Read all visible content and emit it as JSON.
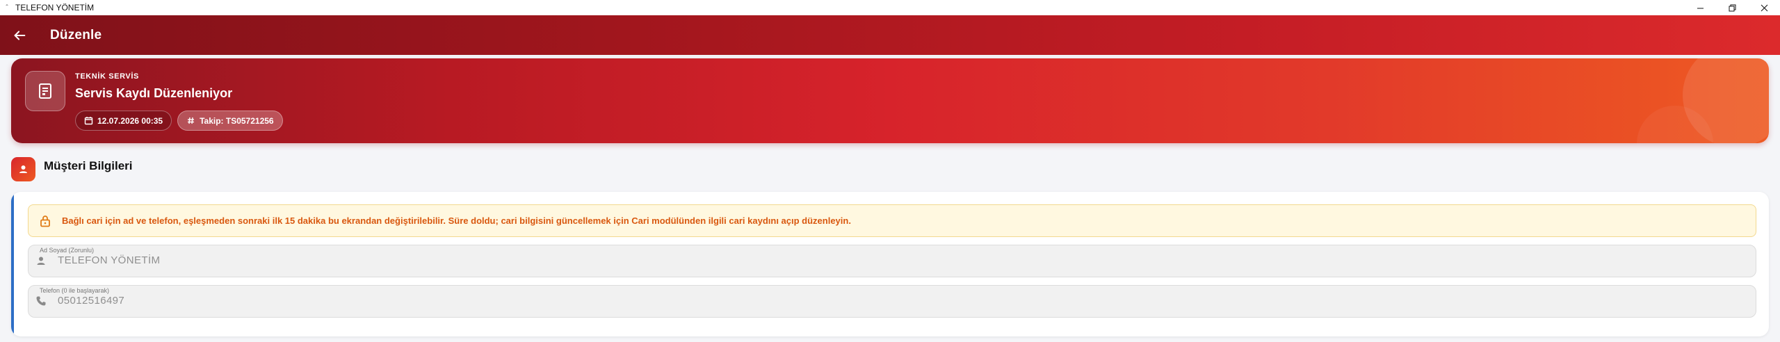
{
  "window": {
    "title": "TELEFON YÖNETİM",
    "app_glyph": "ˆ",
    "controls": [
      {
        "name": "minimize",
        "icon": "minimize-icon"
      },
      {
        "name": "restore",
        "icon": "restore-icon"
      },
      {
        "name": "close",
        "icon": "close-icon"
      }
    ]
  },
  "appbar": {
    "back_icon": "arrow-left-icon",
    "title": "Düzenle",
    "gradient": [
      "#7f1119",
      "#dc2a2c"
    ]
  },
  "header": {
    "icon": "receipt-icon",
    "eyebrow": "TEKNİK SERVİS",
    "title": "Servis Kaydı Düzenleniyor",
    "date_chip": {
      "icon": "calendar-icon",
      "text": "12.07.2026 00:35"
    },
    "track_chip": {
      "icon": "hash-icon",
      "text": "Takip: TS05721256"
    },
    "gradient": [
      "#8c1520",
      "#ee5a22"
    ]
  },
  "customer_section": {
    "icon": "person-icon",
    "title": "Müşteri Bilgileri",
    "accent_color": "#2d6ec6",
    "notice": {
      "icon": "lock-icon",
      "text": "Bağlı cari için ad ve telefon, eşleşmeden sonraki ilk 15 dakika bu ekrandan değiştirilebilir. Süre doldu; cari bilgisini güncellemek için Cari modülünden ilgili cari kaydını açıp düzenleyin.",
      "text_color": "#d9580f",
      "background": "#fff8e0"
    },
    "fields": {
      "name": {
        "label": "Ad Soyad (Zorunlu)",
        "icon": "person-icon",
        "value": "TELEFON YÖNETİM"
      },
      "phone": {
        "label": "Telefon (0 ile başlayarak)",
        "icon": "phone-icon",
        "value": "05012516497"
      }
    }
  }
}
